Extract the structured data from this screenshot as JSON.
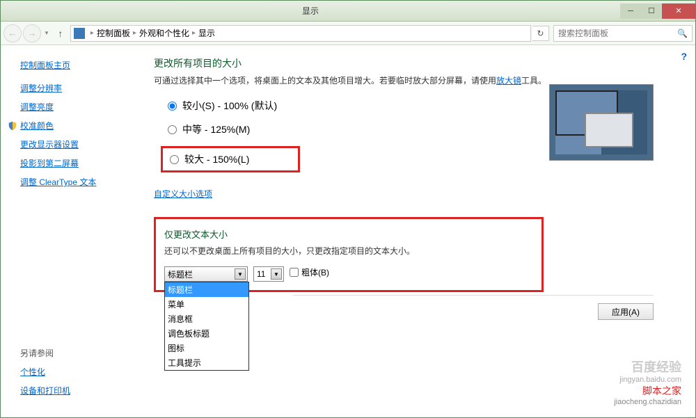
{
  "window": {
    "title": "显示"
  },
  "breadcrumb": {
    "root": "控制面板",
    "mid": "外观和个性化",
    "leaf": "显示"
  },
  "search": {
    "placeholder": "搜索控制面板"
  },
  "sidebar": {
    "home": "控制面板主页",
    "items": [
      "调整分辨率",
      "调整亮度",
      "校准颜色",
      "更改显示器设置",
      "投影到第二屏幕",
      "调整 ClearType 文本"
    ],
    "see_also": "另请参阅",
    "footer_items": [
      "个性化",
      "设备和打印机"
    ]
  },
  "size_section": {
    "title": "更改所有项目的大小",
    "desc_pre": "可通过选择其中一个选项，将桌面上的文本及其他项目增大。若要临时放大部分屏幕，请使用",
    "desc_link": "放大镜",
    "desc_post": "工具。",
    "options": [
      {
        "label": "较小(S) - 100% (默认)",
        "checked": true
      },
      {
        "label": "中等 - 125%(M)",
        "checked": false
      },
      {
        "label": "较大 - 150%(L)",
        "checked": false
      }
    ],
    "custom_link": "自定义大小选项"
  },
  "text_section": {
    "title": "仅更改文本大小",
    "desc": "还可以不更改桌面上所有项目的大小，只更改指定项目的文本大小。",
    "selected": "标题栏",
    "font_size": "11",
    "bold_label": "粗体(B)",
    "dropdown_items": [
      "标题栏",
      "菜单",
      "消息框",
      "调色板标题",
      "图标",
      "工具提示"
    ]
  },
  "apply_button": "应用(A)",
  "watermark": {
    "main": "百度经验",
    "sub": "jingyan.baidu.com",
    "red": "脚本之家",
    "red_sub": "jiaocheng.chazidian"
  }
}
